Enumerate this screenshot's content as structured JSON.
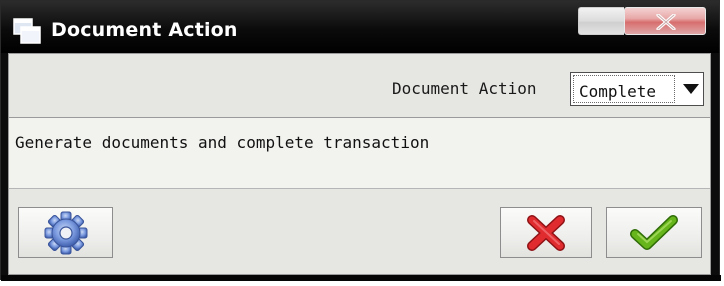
{
  "window": {
    "title": "Document Action"
  },
  "form": {
    "action_label": "Document Action",
    "action_value": "Complete",
    "description": "Generate documents and complete transaction"
  },
  "icons": {
    "app": "window-icon",
    "close": "close-icon",
    "settings": "gear-icon",
    "cancel": "cancel-x-icon",
    "ok": "checkmark-icon"
  },
  "colors": {
    "cancel_icon": "#d9262b",
    "ok_icon": "#5aa313",
    "gear_icon": "#5b7fd0",
    "close_button": "#d86e6e"
  }
}
